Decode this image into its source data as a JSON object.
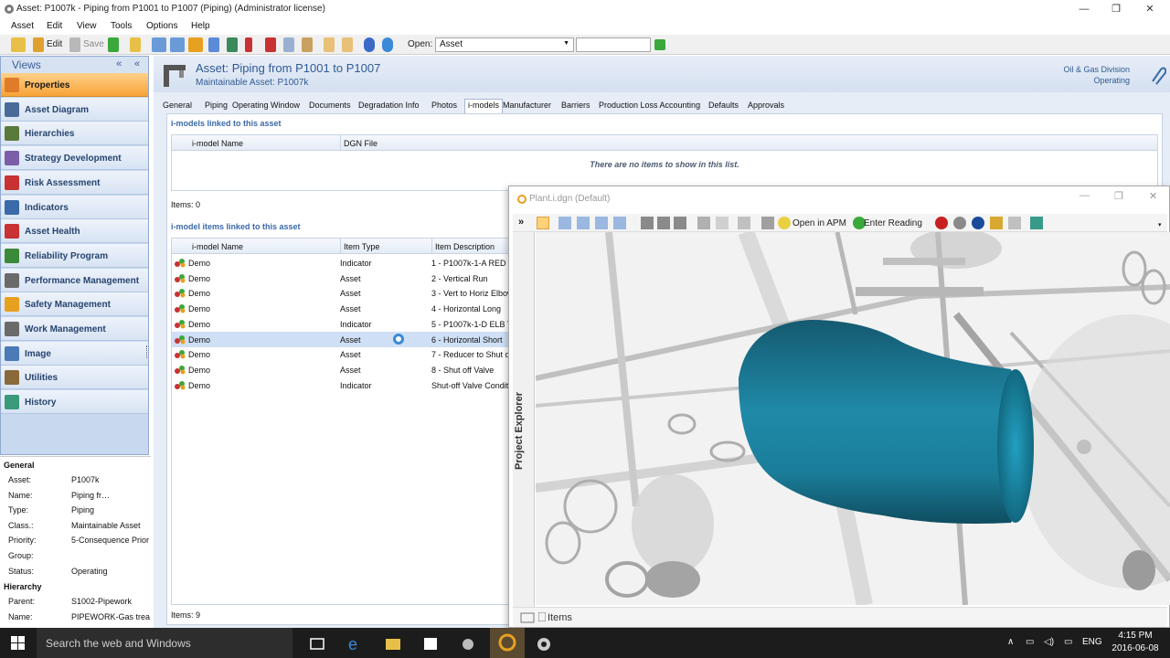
{
  "window": {
    "title": "Asset: P1007k - Piping from P1001 to P1007 (Piping) (Administrator license)",
    "controls": {
      "minimize": "—",
      "maximize": "❐",
      "close": "✕"
    }
  },
  "menu": [
    "Asset",
    "Edit",
    "View",
    "Tools",
    "Options",
    "Help"
  ],
  "toolbar": {
    "edit_label": "Edit",
    "save_label": "Save",
    "open_label": "Open:",
    "open_value": "Asset",
    "open_input": ""
  },
  "views": {
    "title": "Views",
    "items": [
      {
        "label": "Properties",
        "icon": "properties-icon",
        "color": "#e07b2a"
      },
      {
        "label": "Asset Diagram",
        "icon": "diagram-icon",
        "color": "#4a6b9a"
      },
      {
        "label": "Hierarchies",
        "icon": "hierarchy-icon",
        "color": "#5a7a3a"
      },
      {
        "label": "Strategy Development",
        "icon": "strategy-icon",
        "color": "#7b5ea7"
      },
      {
        "label": "Risk Assessment",
        "icon": "risk-icon",
        "color": "#c83232"
      },
      {
        "label": "Indicators",
        "icon": "indicator-icon",
        "color": "#3a6aa8"
      },
      {
        "label": "Asset Health",
        "icon": "health-icon",
        "color": "#c83232"
      },
      {
        "label": "Reliability Program",
        "icon": "reliability-icon",
        "color": "#3a8a3a"
      },
      {
        "label": "Performance Management",
        "icon": "performance-icon",
        "color": "#6a6a6a"
      },
      {
        "label": "Safety Management",
        "icon": "safety-icon",
        "color": "#e8a020"
      },
      {
        "label": "Work Management",
        "icon": "work-icon",
        "color": "#6a6a6a"
      },
      {
        "label": "Image",
        "icon": "image-icon",
        "color": "#4a7ab8"
      },
      {
        "label": "Utilities",
        "icon": "utilities-icon",
        "color": "#8a6a3a"
      },
      {
        "label": "History",
        "icon": "history-icon",
        "color": "#3a9a7a"
      }
    ]
  },
  "properties": {
    "general_header": "General",
    "general": [
      {
        "key": "Asset:",
        "value": "P1007k"
      },
      {
        "key": "Name:",
        "value": "Piping fr…"
      },
      {
        "key": "Type:",
        "value": "Piping"
      },
      {
        "key": "Class.:",
        "value": "Maintainable Asset"
      },
      {
        "key": "Priority:",
        "value": "5-Consequence Prior"
      },
      {
        "key": "Group:",
        "value": ""
      },
      {
        "key": "Status:",
        "value": "Operating"
      }
    ],
    "hierarchy_header": "Hierarchy",
    "hierarchy": [
      {
        "key": "Parent:",
        "value": "S1002-Pipework"
      },
      {
        "key": "Name:",
        "value": "PIPEWORK-Gas trea"
      }
    ]
  },
  "asset_header": {
    "title": "Asset: Piping from P1001 to P1007",
    "subtitle": "Maintainable Asset:  P1007k",
    "division": "Oil & Gas Division",
    "status": "Operating"
  },
  "tabs": [
    "General",
    "Piping",
    "Operating Window",
    "Documents",
    "Degradation Info",
    "Photos",
    "i-models",
    "Manufacturer",
    "Barriers",
    "Production Loss Accounting",
    "Defaults",
    "Approvals"
  ],
  "imodels_linked": {
    "title": "i-models linked to this asset",
    "columns": [
      "i-model Name",
      "DGN File"
    ],
    "empty_text": "There are no items to show in this list.",
    "count": "Items: 0"
  },
  "imodel_items": {
    "title": "i-model items linked to this asset",
    "columns": [
      "i-model Name",
      "Item Type",
      "Item Description"
    ],
    "rows": [
      {
        "name": "Demo",
        "type": "Indicator",
        "desc": "1 - P1007k-1-A RED T"
      },
      {
        "name": "Demo",
        "type": "Asset",
        "desc": "2 - Vertical Run"
      },
      {
        "name": "Demo",
        "type": "Asset",
        "desc": "3 - Vert to Horiz Elbow"
      },
      {
        "name": "Demo",
        "type": "Asset",
        "desc": "4 - Horizontal Long"
      },
      {
        "name": "Demo",
        "type": "Indicator",
        "desc": "5 - P1007k-1-D ELB T"
      },
      {
        "name": "Demo",
        "type": "Asset",
        "desc": "6 - Horizontal Short"
      },
      {
        "name": "Demo",
        "type": "Asset",
        "desc": "7 - Reducer to Shut o"
      },
      {
        "name": "Demo",
        "type": "Asset",
        "desc": "8 - Shut off Valve"
      },
      {
        "name": "Demo",
        "type": "Indicator",
        "desc": "Shut-off Valve Condit"
      }
    ],
    "count": "Items: 9"
  },
  "plant_window": {
    "title": "Plant.i.dgn (Default)",
    "toolbar_text_1": "Open in APM",
    "toolbar_text_2": "Enter Reading",
    "side_label": "Project Explorer",
    "status_label": "Items",
    "pipe_color": "#1d7d98"
  },
  "taskbar": {
    "search_placeholder": "Search the web and Windows",
    "language": "ENG",
    "time": "4:15 PM",
    "date": "2016-06-08"
  }
}
